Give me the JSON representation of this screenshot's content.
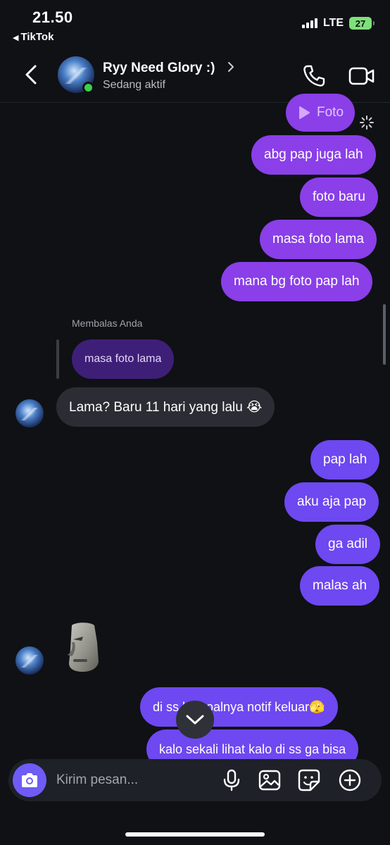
{
  "status_bar": {
    "time": "21.50",
    "back_app": "TikTok",
    "network": "LTE",
    "battery": "27"
  },
  "header": {
    "contact_name": "Ryy Need Glory :)",
    "contact_status": "Sedang aktif"
  },
  "messages": [
    {
      "text": "Foto",
      "from": "me",
      "kind": "attachment"
    },
    {
      "text": "abg pap juga lah",
      "from": "me"
    },
    {
      "text": "foto baru",
      "from": "me"
    },
    {
      "text": "masa foto lama",
      "from": "me"
    },
    {
      "text": "mana bg foto pap lah",
      "from": "me"
    },
    {
      "text": "Lama? Baru 11 hari yang lalu 😭",
      "from": "them",
      "reply_label": "Membalas Anda",
      "reply_quote": "masa foto lama"
    },
    {
      "text": "pap lah",
      "from": "me"
    },
    {
      "text": "aku aja pap",
      "from": "me"
    },
    {
      "text": "ga adil",
      "from": "me"
    },
    {
      "text": "malas ah",
      "from": "me"
    },
    {
      "text": "",
      "from": "them",
      "kind": "sticker",
      "sticker": "moai-face"
    },
    {
      "text": "di ss    bg,soalnya notif keluar🫣",
      "from": "me"
    },
    {
      "text": "kalo sekali lihat kalo di ss ga bisa",
      "from": "me"
    }
  ],
  "composer": {
    "placeholder": "Kirim pesan..."
  },
  "colors": {
    "background": "#0f1115",
    "outgoing_purple": "#8a3fe8",
    "outgoing_violet": "#6e48f0",
    "incoming": "#2a2d33",
    "online": "#3ecf4a",
    "battery": "#7ee07a"
  }
}
